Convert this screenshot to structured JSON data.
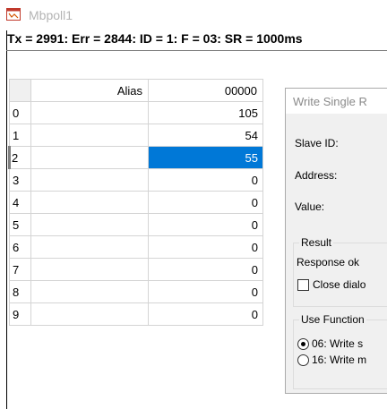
{
  "window": {
    "title": "Mbpoll1"
  },
  "status": {
    "text": "Tx = 2991: Err = 2844: ID = 1: F = 03: SR = 1000ms"
  },
  "table": {
    "headers": {
      "alias": "Alias",
      "address": "00000"
    },
    "rows": [
      {
        "index": "0",
        "alias": "",
        "value": "105"
      },
      {
        "index": "1",
        "alias": "",
        "value": "54"
      },
      {
        "index": "2",
        "alias": "",
        "value": "55"
      },
      {
        "index": "3",
        "alias": "",
        "value": "0"
      },
      {
        "index": "4",
        "alias": "",
        "value": "0"
      },
      {
        "index": "5",
        "alias": "",
        "value": "0"
      },
      {
        "index": "6",
        "alias": "",
        "value": "0"
      },
      {
        "index": "7",
        "alias": "",
        "value": "0"
      },
      {
        "index": "8",
        "alias": "",
        "value": "0"
      },
      {
        "index": "9",
        "alias": "",
        "value": "0"
      }
    ],
    "selected_row": "2"
  },
  "dialog": {
    "title": "Write Single R",
    "slave_id_label": "Slave ID:",
    "address_label": "Address:",
    "value_label": "Value:",
    "result_group": "Result",
    "response_text": "Response ok",
    "close_dialog_label": "Close dialo",
    "use_function_group": "Use Function",
    "option_06": "06: Write s",
    "option_16": "16: Write m"
  },
  "colors": {
    "selection": "#0078d7",
    "status_text": "#000000",
    "title_text": "#b4b4b4"
  },
  "icons": {
    "app": "mbpoll-app-icon"
  }
}
